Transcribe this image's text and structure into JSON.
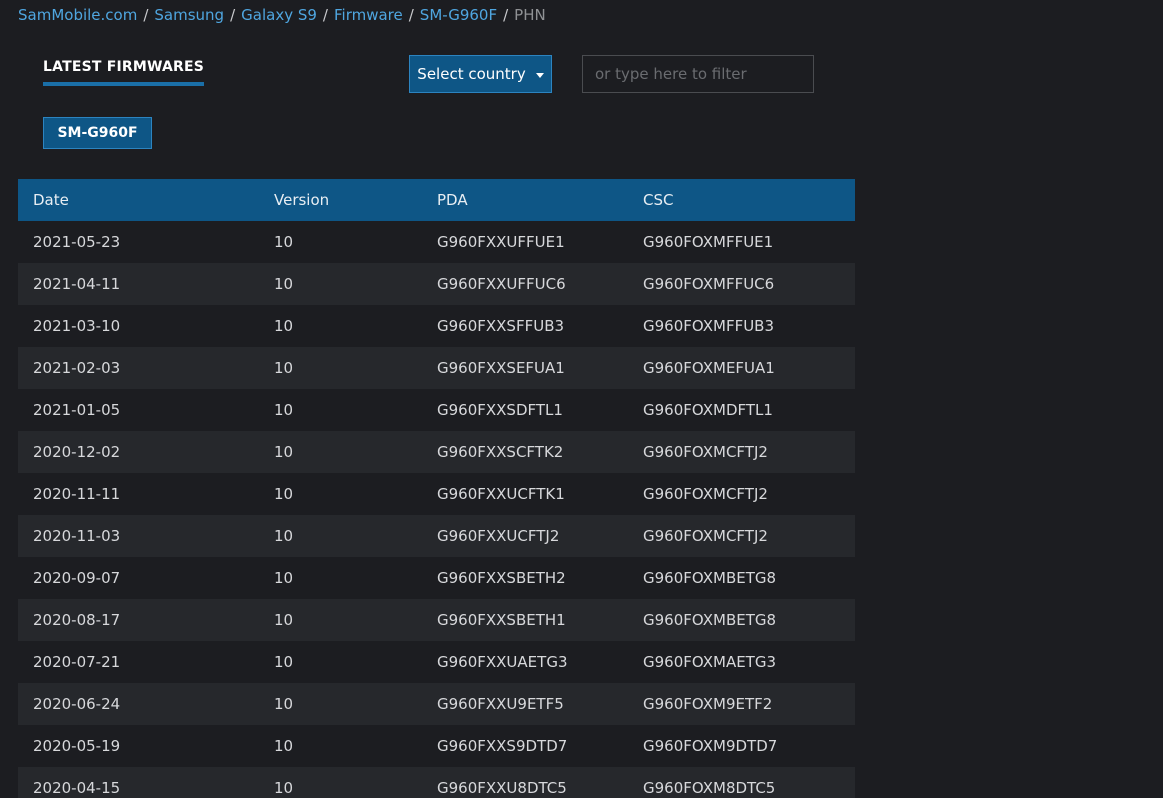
{
  "breadcrumb": {
    "items": [
      "SamMobile.com",
      "Samsung",
      "Galaxy S9",
      "Firmware",
      "SM-G960F"
    ],
    "separator": "/",
    "current": "PHN"
  },
  "section": {
    "title": "LATEST FIRMWARES"
  },
  "country_select": {
    "label": "Select country"
  },
  "filter": {
    "placeholder": "or type here to filter",
    "value": ""
  },
  "model_button": {
    "label": "SM-G960F"
  },
  "table": {
    "headers": [
      "Date",
      "Version",
      "PDA",
      "CSC"
    ],
    "rows": [
      [
        "2021-05-23",
        "10",
        "G960FXXUFFUE1",
        "G960FOXMFFUE1"
      ],
      [
        "2021-04-11",
        "10",
        "G960FXXUFFUC6",
        "G960FOXMFFUC6"
      ],
      [
        "2021-03-10",
        "10",
        "G960FXXSFFUB3",
        "G960FOXMFFUB3"
      ],
      [
        "2021-02-03",
        "10",
        "G960FXXSEFUA1",
        "G960FOXMEFUA1"
      ],
      [
        "2021-01-05",
        "10",
        "G960FXXSDFTL1",
        "G960FOXMDFTL1"
      ],
      [
        "2020-12-02",
        "10",
        "G960FXXSCFTK2",
        "G960FOXMCFTJ2"
      ],
      [
        "2020-11-11",
        "10",
        "G960FXXUCFTK1",
        "G960FOXMCFTJ2"
      ],
      [
        "2020-11-03",
        "10",
        "G960FXXUCFTJ2",
        "G960FOXMCFTJ2"
      ],
      [
        "2020-09-07",
        "10",
        "G960FXXSBETH2",
        "G960FOXMBETG8"
      ],
      [
        "2020-08-17",
        "10",
        "G960FXXSBETH1",
        "G960FOXMBETG8"
      ],
      [
        "2020-07-21",
        "10",
        "G960FXXUAETG3",
        "G960FOXMAETG3"
      ],
      [
        "2020-06-24",
        "10",
        "G960FXXU9ETF5",
        "G960FOXM9ETF2"
      ],
      [
        "2020-05-19",
        "10",
        "G960FXXS9DTD7",
        "G960FOXM9DTD7"
      ],
      [
        "2020-04-15",
        "10",
        "G960FXXU8DTC5",
        "G960FOXM8DTC5"
      ]
    ]
  },
  "colors": {
    "background": "#1c1d21",
    "accent": "#0e5686",
    "link": "#4fa6e0"
  }
}
